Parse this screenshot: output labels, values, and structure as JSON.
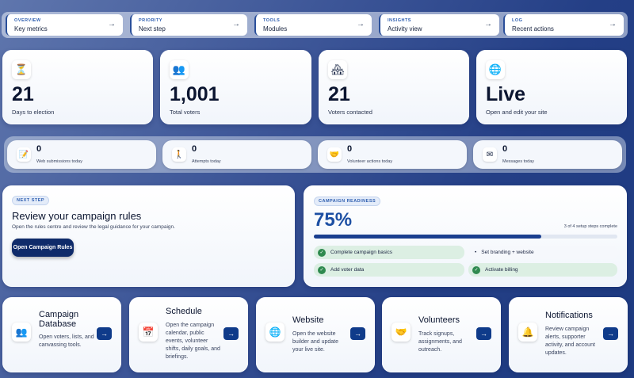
{
  "nav": [
    {
      "cat": "OVERVIEW",
      "label": "Key metrics",
      "arrow": "→"
    },
    {
      "cat": "PRIORITY",
      "label": "Next step",
      "arrow": "→"
    },
    {
      "cat": "TOOLS",
      "label": "Modules",
      "arrow": "→"
    },
    {
      "cat": "INSIGHTS",
      "label": "Activity view",
      "arrow": "→"
    },
    {
      "cat": "LOG",
      "label": "Recent actions",
      "arrow": "→"
    }
  ],
  "stats": [
    {
      "icon": "hourglass-icon",
      "glyph": "⏳",
      "value": "21",
      "label": "Days to election"
    },
    {
      "icon": "people-icon",
      "glyph": "👥",
      "value": "1,001",
      "label": "Total voters"
    },
    {
      "icon": "house-icon",
      "glyph": "🏘",
      "value": "21",
      "label": "Voters contacted"
    },
    {
      "icon": "globe-icon",
      "glyph": "🌐",
      "value": "Live",
      "label": "Open and edit your site"
    }
  ],
  "activity": [
    {
      "icon": "form-icon",
      "glyph": "📝",
      "value": "0",
      "label": "Web submissions today"
    },
    {
      "icon": "walker-icon",
      "glyph": "🚶",
      "value": "0",
      "label": "Attempts today"
    },
    {
      "icon": "handshake-icon",
      "glyph": "🤝",
      "value": "0",
      "label": "Volunteer actions today"
    },
    {
      "icon": "envelope-icon",
      "glyph": "✉",
      "value": "0",
      "label": "Messages today"
    }
  ],
  "next_step": {
    "tag": "NEXT STEP",
    "title": "Review your campaign rules",
    "desc": "Open the rules centre and review the legal guidance for your campaign.",
    "button": "Open Campaign Rules"
  },
  "readiness": {
    "tag": "CAMPAIGN READINESS",
    "percent": "75%",
    "progress": 0.75,
    "steps": "3 of 4 setup steps complete",
    "items": [
      {
        "label": "Complete campaign basics",
        "done": true
      },
      {
        "label": "Set branding + website",
        "done": false
      },
      {
        "label": "Add voter data",
        "done": true
      },
      {
        "label": "Activate billing",
        "done": true
      }
    ],
    "check": "✓",
    "bullet": "•"
  },
  "modules": [
    {
      "icon": "people-icon",
      "glyph": "👥",
      "title1": "Campaign",
      "title2": "Database",
      "desc": "Open voters, lists, and canvassing tools.",
      "arrow": "→"
    },
    {
      "icon": "calendar-icon",
      "glyph": "📅",
      "title1": "Schedule",
      "title2": "",
      "desc": "Open the campaign calendar, public events, volunteer shifts, daily goals, and briefings.",
      "arrow": "→"
    },
    {
      "icon": "globe-icon",
      "glyph": "🌐",
      "title1": "Website",
      "title2": "",
      "desc": "Open the website builder and update your live site.",
      "arrow": "→"
    },
    {
      "icon": "handshake-icon",
      "glyph": "🤝",
      "title1": "Volunteers",
      "title2": "",
      "desc": "Track signups, assignments, and outreach.",
      "arrow": "→"
    },
    {
      "icon": "bell-icon",
      "glyph": "🔔",
      "title1": "Notifications",
      "title2": "",
      "desc": "Review campaign alerts, supporter activity, and account updates.",
      "arrow": "→"
    }
  ]
}
